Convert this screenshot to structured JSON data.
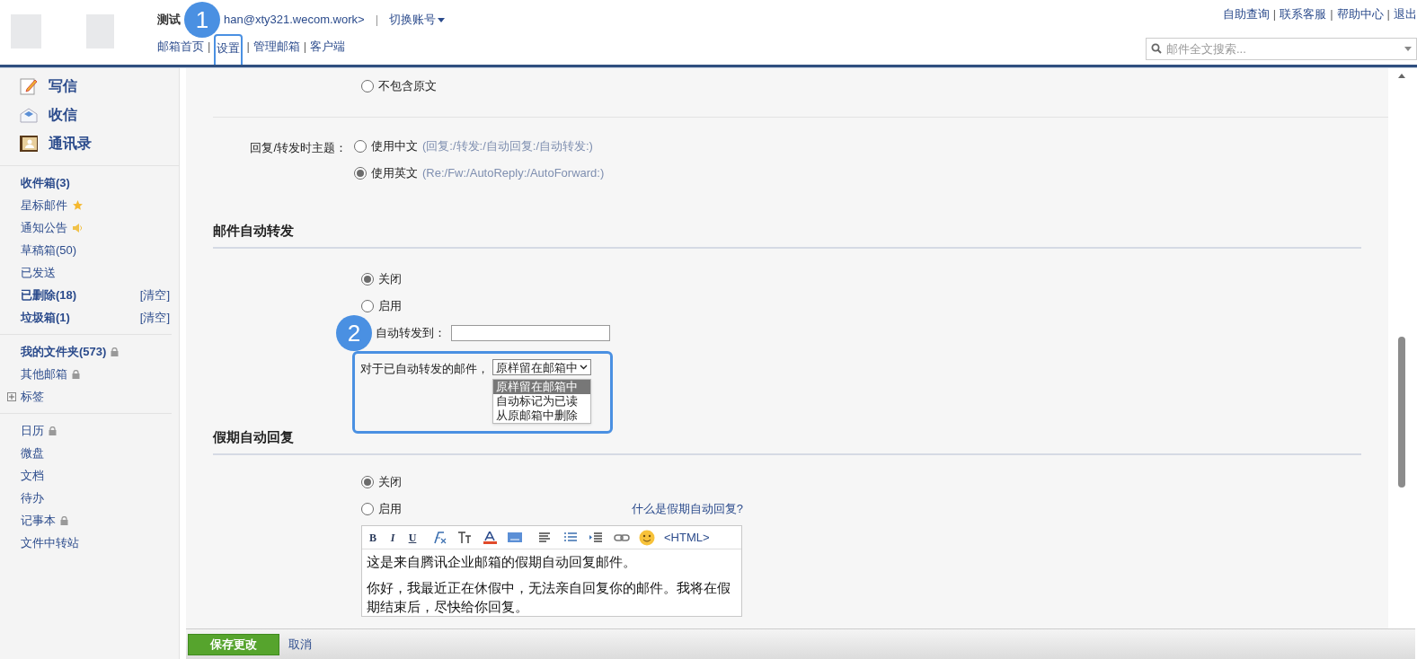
{
  "header": {
    "account_name": "测试",
    "account_email": "han@xty321.wecom.work>",
    "divider": "|",
    "switch_account": "切换账号",
    "nav_separator": "|",
    "nav_links": [
      {
        "label": "邮箱首页",
        "highlighted": false
      },
      {
        "label": "设置",
        "highlighted": true
      },
      {
        "label": "管理邮箱",
        "highlighted": false
      },
      {
        "label": "客户端",
        "highlighted": false
      }
    ],
    "top_links": [
      "自助查询",
      "联系客服",
      "帮助中心",
      "退出"
    ],
    "search": {
      "placeholder": "邮件全文搜索..."
    }
  },
  "callouts": [
    "1",
    "2"
  ],
  "sidebar": {
    "actions": [
      {
        "kind": "compose",
        "label": "写信"
      },
      {
        "kind": "receive",
        "label": "收信"
      },
      {
        "kind": "contacts",
        "label": "通讯录"
      }
    ],
    "groups": [
      [
        {
          "kind": "plain",
          "label": "收件箱(3)",
          "bold": true
        },
        {
          "kind": "starred",
          "label": "星标邮件",
          "bold": false
        },
        {
          "kind": "announcement",
          "label": "通知公告",
          "bold": false
        },
        {
          "kind": "plain",
          "label": "草稿箱(50)",
          "bold": false
        },
        {
          "kind": "plain",
          "label": "已发送",
          "bold": false
        },
        {
          "kind": "plain",
          "label": "已删除(18)",
          "bold": true,
          "action": "[清空]"
        },
        {
          "kind": "plain",
          "label": "垃圾箱(1)",
          "bold": true,
          "action": "[清空]"
        }
      ],
      [
        {
          "kind": "locked",
          "label": "我的文件夹(573)",
          "bold": true
        },
        {
          "kind": "locked",
          "label": "其他邮箱",
          "bold": false
        },
        {
          "kind": "plain",
          "label": "标签",
          "bold": false,
          "expanded": false
        }
      ],
      [
        {
          "kind": "locked",
          "label": "日历",
          "bold": false
        },
        {
          "kind": "plain",
          "label": "微盘",
          "bold": false
        },
        {
          "kind": "plain",
          "label": "文档",
          "bold": false
        },
        {
          "kind": "plain",
          "label": "待办",
          "bold": false
        },
        {
          "kind": "locked",
          "label": "记事本",
          "bold": false
        },
        {
          "kind": "plain",
          "label": "文件中转站",
          "bold": false
        }
      ]
    ]
  },
  "settings": {
    "quote_option": {
      "label": "不包含原文",
      "selected": false
    },
    "subject": {
      "label": "回复/转发时主题：",
      "options": [
        {
          "label": "使用中文",
          "hint": "(回复:/转发:/自动回复:/自动转发:)",
          "selected": false
        },
        {
          "label": "使用英文",
          "hint": "(Re:/Fw:/AutoReply:/AutoForward:)",
          "selected": true
        }
      ]
    },
    "auto_forward": {
      "title": "邮件自动转发",
      "options": [
        {
          "label": "关闭",
          "selected": true
        },
        {
          "label": "启用",
          "selected": false
        }
      ],
      "forward_to_label": "自动转发到：",
      "after_forward_label": "对于已自动转发的邮件，",
      "select_value": "原样留在邮箱中",
      "dropdown_options": [
        {
          "label": "原样留在邮箱中",
          "selected": true
        },
        {
          "label": "自动标记为已读",
          "selected": false
        },
        {
          "label": "从原邮箱中删除",
          "selected": false
        }
      ]
    },
    "vacation_reply": {
      "title": "假期自动回复",
      "options": [
        {
          "label": "关闭",
          "selected": true
        },
        {
          "label": "启用",
          "selected": false
        }
      ],
      "help_link": "什么是假期自动回复?",
      "toolbar": {
        "format_buttons": [
          "B",
          "I",
          "U"
        ],
        "html_button": "<HTML>"
      },
      "editor_paragraphs": [
        "这是来自腾讯企业邮箱的假期自动回复邮件。",
        "你好，我最近正在休假中，无法亲自回复你的邮件。我将在假期结束后，尽快给你回复。"
      ]
    }
  },
  "footer": {
    "save_button": "保存更改",
    "cancel_link": "取消"
  }
}
